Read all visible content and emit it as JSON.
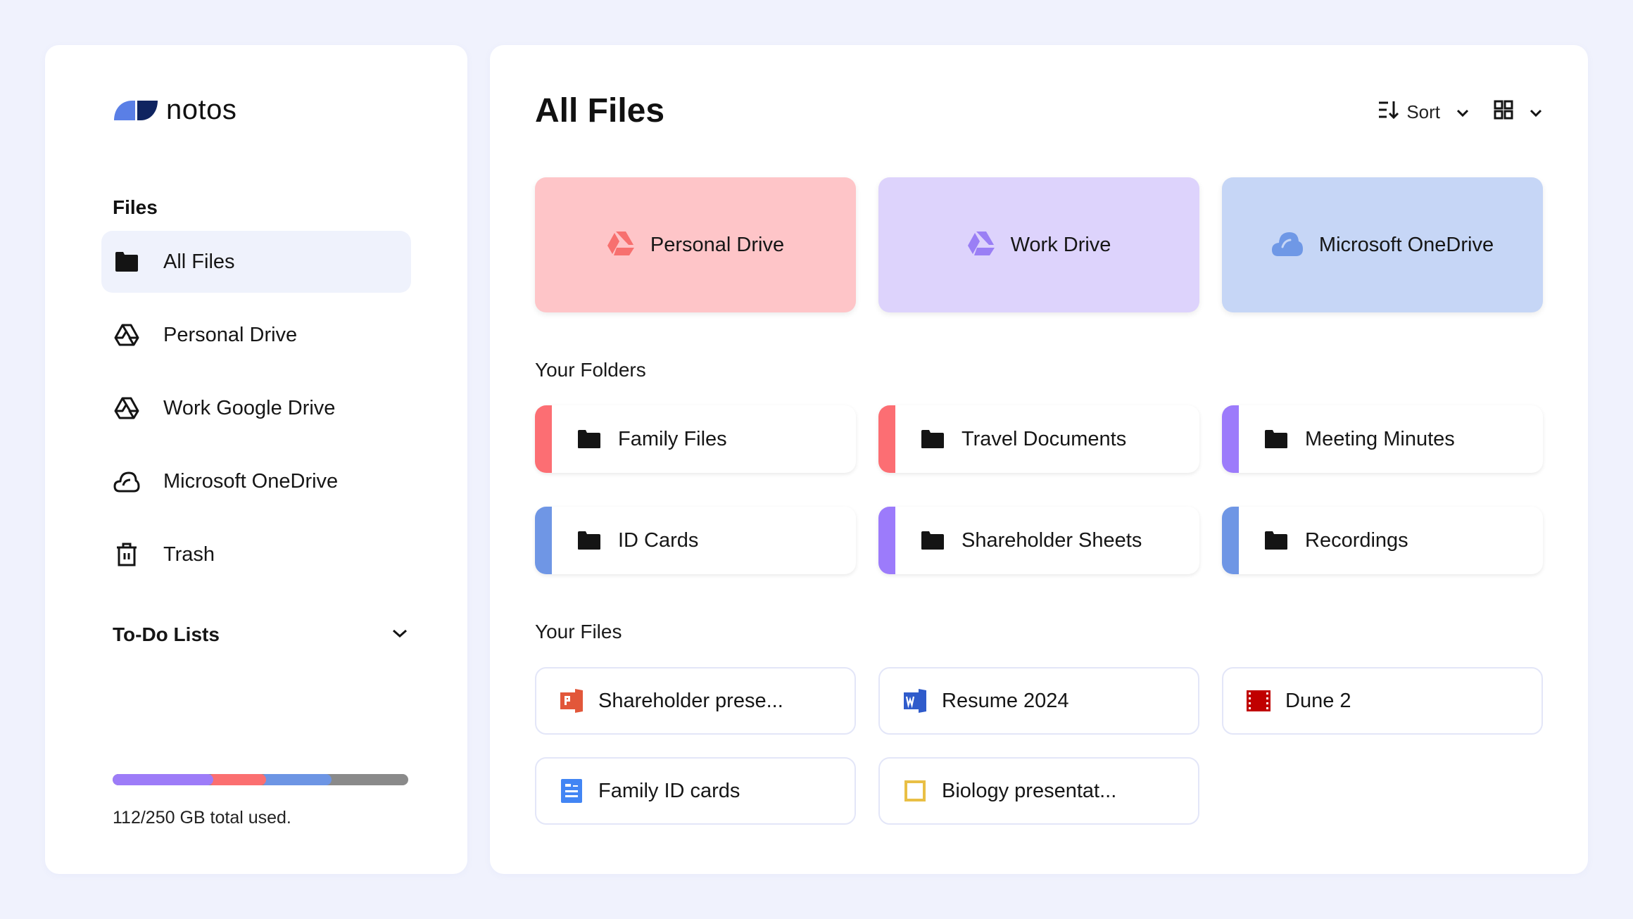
{
  "app": {
    "name": "notos",
    "logo_colors": {
      "left": "#5a7fe6",
      "right": "#0f2460"
    }
  },
  "sidebar": {
    "files_heading": "Files",
    "items": [
      {
        "label": "All Files",
        "icon": "folder-icon",
        "active": true
      },
      {
        "label": "Personal Drive",
        "icon": "google-drive-icon",
        "active": false
      },
      {
        "label": "Work Google Drive",
        "icon": "google-drive-icon",
        "active": false
      },
      {
        "label": "Microsoft OneDrive",
        "icon": "cloud-icon",
        "active": false
      },
      {
        "label": "Trash",
        "icon": "trash-icon",
        "active": false
      }
    ],
    "todo_heading": "To-Do Lists",
    "todo_expanded": false,
    "storage": {
      "used_gb": 112,
      "total_gb": 250,
      "text": "112/250 GB total used.",
      "segments": [
        {
          "name": "Work Drive",
          "fraction": 0.34,
          "color": "#9d7cf8"
        },
        {
          "name": "Personal Drive",
          "fraction": 0.18,
          "color": "#fb6f70"
        },
        {
          "name": "Microsoft OneDrive",
          "fraction": 0.22,
          "color": "#6d95e4"
        }
      ],
      "remaining_color": "#8a8a8a"
    }
  },
  "main": {
    "title": "All Files",
    "toolbar": {
      "sort_label": "Sort",
      "sort_icon": "sort-descending-icon",
      "view_icon": "grid-view-icon"
    },
    "drives": [
      {
        "label": "Personal Drive",
        "icon": "google-drive-icon",
        "bg": "#fec5c8",
        "icon_color": "#f7706f"
      },
      {
        "label": "Work Drive",
        "icon": "google-drive-icon",
        "bg": "#ddd3fc",
        "icon_color": "#9a7ff5"
      },
      {
        "label": "Microsoft OneDrive",
        "icon": "cloud-icon",
        "bg": "#c6d6f6",
        "icon_color": "#6f98e6"
      }
    ],
    "folders_heading": "Your Folders",
    "folders": [
      {
        "label": "Family Files",
        "accent": "#fc6e73"
      },
      {
        "label": "Travel Documents",
        "accent": "#fc6e73"
      },
      {
        "label": "Meeting Minutes",
        "accent": "#9c7bfb"
      },
      {
        "label": "ID Cards",
        "accent": "#6f96e5"
      },
      {
        "label": "Shareholder Sheets",
        "accent": "#9c7bfb"
      },
      {
        "label": "Recordings",
        "accent": "#6f96e5"
      }
    ],
    "files_heading": "Your Files",
    "files": [
      {
        "label": "Shareholder prese...",
        "icon": "powerpoint-icon",
        "color": "#e2573a"
      },
      {
        "label": "Resume 2024",
        "icon": "word-icon",
        "color": "#2f5bcb"
      },
      {
        "label": "Dune 2",
        "icon": "film-icon",
        "color": "#c00000"
      },
      {
        "label": "Family ID cards",
        "icon": "google-docs-icon",
        "color": "#4285f4"
      },
      {
        "label": "Biology presentat...",
        "icon": "google-slides-icon",
        "color": "#e9bf45"
      }
    ]
  }
}
